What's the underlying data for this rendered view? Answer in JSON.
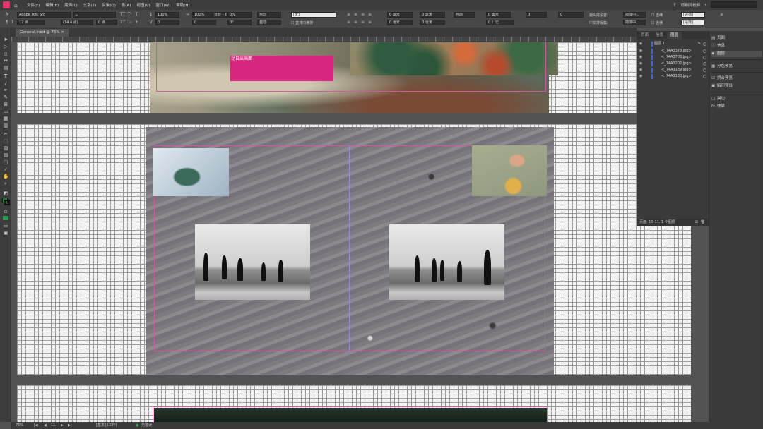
{
  "menubar": {
    "items": [
      "文件(F)",
      "编辑(E)",
      "版面(L)",
      "文字(T)",
      "对象(O)",
      "表(A)",
      "视图(V)",
      "窗口(W)",
      "帮助(H)"
    ],
    "workspace": "印刷和校样"
  },
  "control": {
    "font_family": "Adobe 宋体 Std",
    "font_style": "L",
    "font_size": "12 点",
    "leading": "(14.4 点)",
    "kerning": "0",
    "tracking": "0",
    "vertical_scale": "100%",
    "horizontal_scale": "100%",
    "baseline_shift": "0 点",
    "skew": "0°",
    "language": "显显 - 日",
    "tsume": "0%",
    "auto_1": "自动",
    "auto_2": "自动",
    "char_style": "[无]",
    "direction_label": "直排内横排",
    "para_indent": "0 毫米",
    "para_indent_2": "0 毫米",
    "space_before": "0 毫米",
    "space_after": "0 毫米",
    "auto_3": "自动",
    "zero_1": "0",
    "zero_2": "0",
    "kinsoku_label": "避头尾设置:",
    "kinsoku_value": "简体中...",
    "mojikumi_label": "中文排版集:",
    "mojikumi_value": "简体中...",
    "none_1": "无",
    "strip_1": "[段落]",
    "strip_2": "[段落]",
    "checkbox_1": "连续",
    "checkbox_2": "连续",
    "mm_1": "0 毫米",
    "mm_2": "0 毫米"
  },
  "document": {
    "tab_title": "General.indd @ 75% ×"
  },
  "canvas": {
    "text_frame_label": "动日出画面"
  },
  "panel": {
    "tabs": [
      "页面",
      "信息",
      "图层"
    ],
    "active_tab": "图层",
    "layer_name": "图层 1",
    "items": [
      "<_74A3378.jpg>",
      "<_74A3708.jpg>",
      "<_74A3202.jpg>",
      "<_74A3189.jpg>",
      "<_74A3133.jpg>"
    ],
    "footer": "页面: 10-11, 1 个图层"
  },
  "dock": {
    "items": [
      {
        "label": "页面",
        "icon": "pages-icon"
      },
      {
        "label": "信息",
        "icon": "info-icon"
      },
      {
        "label": "图层",
        "icon": "layers-icon"
      },
      {
        "label": "分色预览",
        "icon": "separations-icon"
      },
      {
        "label": "拼合预览",
        "icon": "flattener-icon"
      },
      {
        "label": "陷印预设",
        "icon": "trap-icon"
      },
      {
        "label": "描边",
        "icon": "stroke-icon"
      },
      {
        "label": "效果",
        "icon": "effects-icon"
      }
    ]
  },
  "status": {
    "zoom": "75%",
    "page": "11",
    "preset": "[基本] (工作)",
    "errors": "无错误"
  },
  "colors": {
    "accent_magenta": "#d6267e",
    "ui_dark": "#3a3a3a",
    "pasteboard": "#535353",
    "layer_color": "#3b6bd6"
  }
}
